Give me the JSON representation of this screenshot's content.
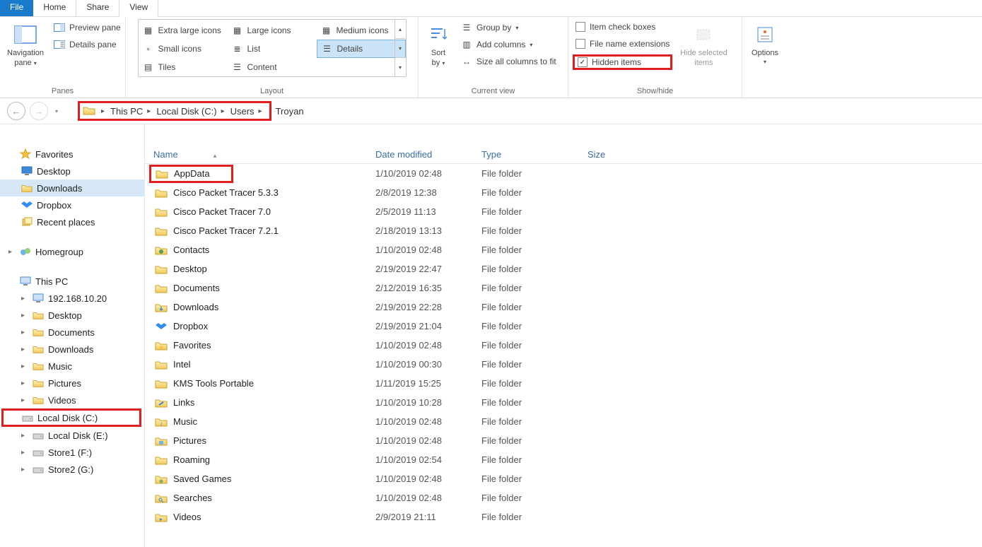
{
  "tabs": {
    "file": "File",
    "home": "Home",
    "share": "Share",
    "view": "View"
  },
  "ribbon": {
    "panes": {
      "nav": "Navigation",
      "nav2": "pane",
      "preview": "Preview pane",
      "details": "Details pane",
      "label": "Panes"
    },
    "layout": {
      "xl": "Extra large icons",
      "lg": "Large icons",
      "md": "Medium icons",
      "sm": "Small icons",
      "list": "List",
      "details": "Details",
      "tiles": "Tiles",
      "content": "Content",
      "label": "Layout"
    },
    "current": {
      "sort": "Sort",
      "sort2": "by",
      "group": "Group by",
      "addcols": "Add columns",
      "sizecols": "Size all columns to fit",
      "label": "Current view"
    },
    "showhide": {
      "itemcheck": "Item check boxes",
      "fileext": "File name extensions",
      "hidden": "Hidden items",
      "hidesel": "Hide selected",
      "hidesel2": "items",
      "options": "Options",
      "label": "Show/hide"
    }
  },
  "breadcrumb": {
    "thispc": "This PC",
    "localdisk": "Local Disk (C:)",
    "users": "Users",
    "trail": "Troyan"
  },
  "columns": {
    "name": "Name",
    "date": "Date modified",
    "type": "Type",
    "size": "Size"
  },
  "sidebar": {
    "favorites": "Favorites",
    "fav_items": [
      {
        "label": "Desktop",
        "icon": "desktop"
      },
      {
        "label": "Downloads",
        "icon": "folder",
        "selected": true
      },
      {
        "label": "Dropbox",
        "icon": "dropbox"
      },
      {
        "label": "Recent places",
        "icon": "recent"
      }
    ],
    "homegroup": "Homegroup",
    "thispc": "This PC",
    "pc_items": [
      {
        "label": "192.168.10.20",
        "icon": "netpc"
      },
      {
        "label": "Desktop",
        "icon": "folder"
      },
      {
        "label": "Documents",
        "icon": "folder"
      },
      {
        "label": "Downloads",
        "icon": "folder"
      },
      {
        "label": "Music",
        "icon": "folder"
      },
      {
        "label": "Pictures",
        "icon": "folder"
      },
      {
        "label": "Videos",
        "icon": "folder"
      },
      {
        "label": "Local Disk (C:)",
        "icon": "drive",
        "hilite": true
      },
      {
        "label": "Local Disk (E:)",
        "icon": "drive"
      },
      {
        "label": "Store1 (F:)",
        "icon": "drive"
      },
      {
        "label": "Store2 (G:)",
        "icon": "drive"
      }
    ]
  },
  "rows": [
    {
      "name": "AppData",
      "date": "1/10/2019 02:48",
      "type": "File folder",
      "hilite": true
    },
    {
      "name": "Cisco Packet Tracer 5.3.3",
      "date": "2/8/2019 12:38",
      "type": "File folder"
    },
    {
      "name": "Cisco Packet Tracer 7.0",
      "date": "2/5/2019 11:13",
      "type": "File folder"
    },
    {
      "name": "Cisco Packet Tracer 7.2.1",
      "date": "2/18/2019 13:13",
      "type": "File folder"
    },
    {
      "name": "Contacts",
      "date": "1/10/2019 02:48",
      "type": "File folder",
      "icon": "contacts"
    },
    {
      "name": "Desktop",
      "date": "2/19/2019 22:47",
      "type": "File folder"
    },
    {
      "name": "Documents",
      "date": "2/12/2019 16:35",
      "type": "File folder"
    },
    {
      "name": "Downloads",
      "date": "2/19/2019 22:28",
      "type": "File folder",
      "icon": "downloads"
    },
    {
      "name": "Dropbox",
      "date": "2/19/2019 21:04",
      "type": "File folder",
      "icon": "dropbox"
    },
    {
      "name": "Favorites",
      "date": "1/10/2019 02:48",
      "type": "File folder",
      "icon": "favorites"
    },
    {
      "name": "Intel",
      "date": "1/10/2019 00:30",
      "type": "File folder"
    },
    {
      "name": "KMS Tools Portable",
      "date": "1/11/2019 15:25",
      "type": "File folder"
    },
    {
      "name": "Links",
      "date": "1/10/2019 10:28",
      "type": "File folder",
      "icon": "links"
    },
    {
      "name": "Music",
      "date": "1/10/2019 02:48",
      "type": "File folder",
      "icon": "music"
    },
    {
      "name": "Pictures",
      "date": "1/10/2019 02:48",
      "type": "File folder",
      "icon": "pictures"
    },
    {
      "name": "Roaming",
      "date": "1/10/2019 02:54",
      "type": "File folder"
    },
    {
      "name": "Saved Games",
      "date": "1/10/2019 02:48",
      "type": "File folder",
      "icon": "games"
    },
    {
      "name": "Searches",
      "date": "1/10/2019 02:48",
      "type": "File folder",
      "icon": "search"
    },
    {
      "name": "Videos",
      "date": "2/9/2019 21:11",
      "type": "File folder",
      "icon": "videos"
    }
  ]
}
